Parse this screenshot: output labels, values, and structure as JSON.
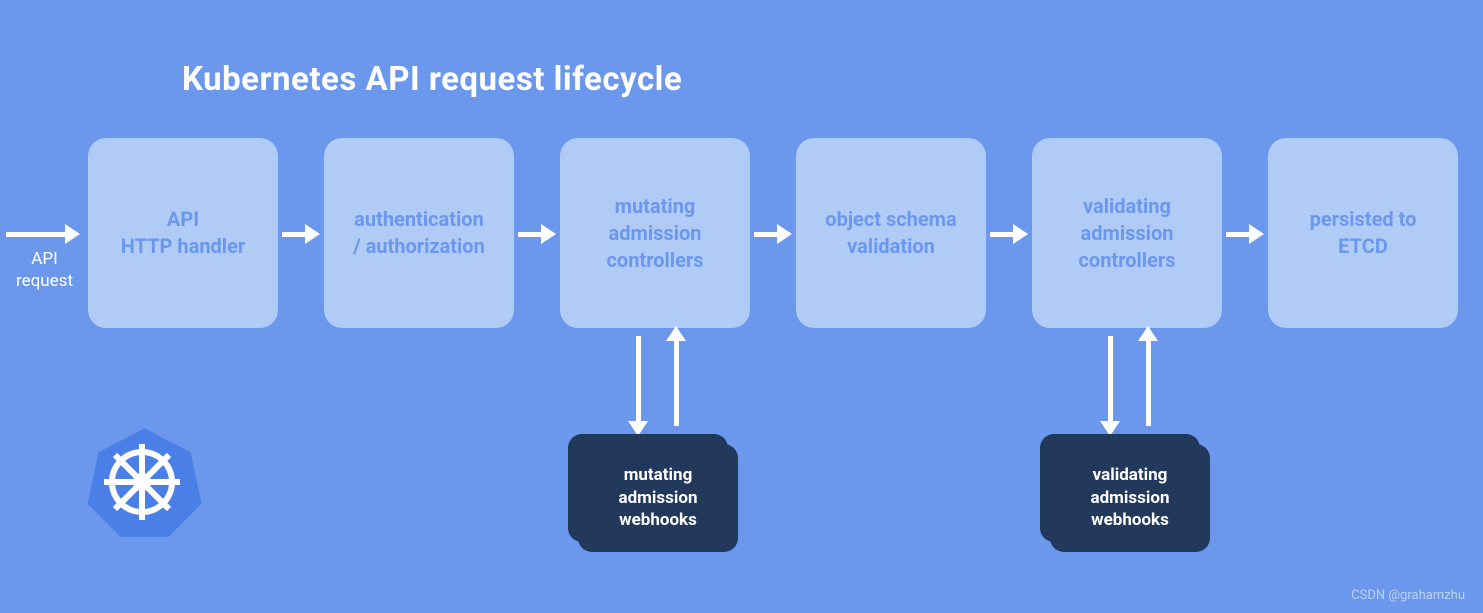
{
  "title": "Kubernetes API request lifecycle",
  "entry_label": "API\nrequest",
  "boxes": [
    {
      "label": "API\nHTTP handler"
    },
    {
      "label": "authentication\n/ authorization"
    },
    {
      "label": "mutating\nadmission\ncontrollers"
    },
    {
      "label": "object schema\nvalidation"
    },
    {
      "label": "validating\nadmission\ncontrollers"
    },
    {
      "label": "persisted to\nETCD"
    }
  ],
  "webhooks": [
    {
      "label": "mutating\nadmission\nwebhooks"
    },
    {
      "label": "validating\nadmission\nwebhooks"
    }
  ],
  "logo": {
    "name": "kubernetes-logo"
  },
  "watermark": "CSDN @grahamzhu",
  "colors": {
    "background": "#6b98ed",
    "box_light": "#b1cbf7",
    "box_dark": "#22395c",
    "arrow": "#ffffff",
    "title_text": "#ffffff",
    "box_text": "#6b98ed",
    "logo_fill": "#4a7fe8"
  }
}
